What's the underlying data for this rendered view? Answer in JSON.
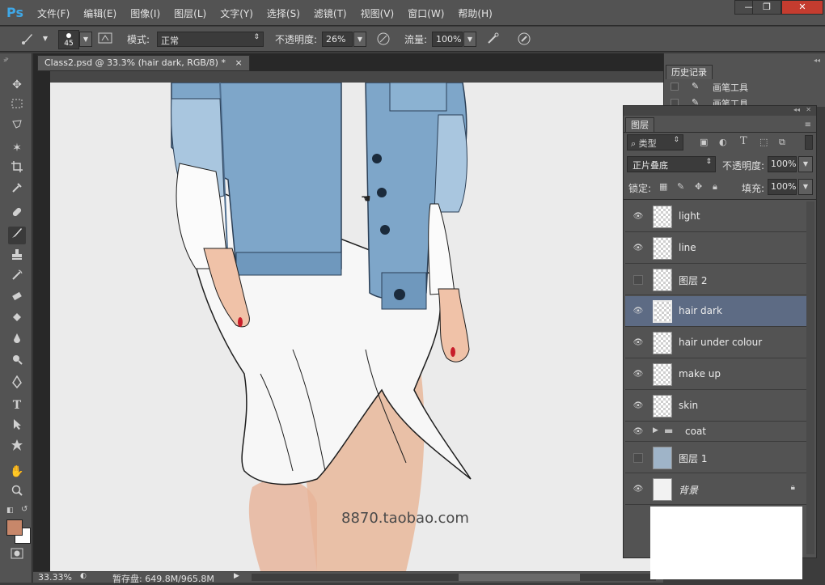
{
  "app": {
    "logo": "Ps"
  },
  "menu": [
    "文件(F)",
    "编辑(E)",
    "图像(I)",
    "图层(L)",
    "文字(Y)",
    "选择(S)",
    "滤镜(T)",
    "视图(V)",
    "窗口(W)",
    "帮助(H)"
  ],
  "window_controls": {
    "minimize": "—",
    "restore": "❐",
    "close": "✕"
  },
  "options": {
    "brush_size": "45",
    "mode_label": "模式:",
    "mode_value": "正常",
    "opacity_label": "不透明度:",
    "opacity_value": "26%",
    "flow_label": "流量:",
    "flow_value": "100%"
  },
  "document": {
    "tab_title": "Class2.psd @ 33.3% (hair dark, RGB/8) *",
    "tab_close": "×"
  },
  "status": {
    "zoom": "33.33%",
    "scratch": "暂存盘: 649.8M/965.8M"
  },
  "watermark": "8870.taobao.com",
  "history": {
    "tab": "历史记录",
    "items": [
      "画笔工具",
      "画笔工具"
    ]
  },
  "layers": {
    "tab": "图层",
    "filter_kind": "类型",
    "blend_mode": "正片叠底",
    "opacity_label": "不透明度:",
    "opacity_value": "100%",
    "lock_label": "锁定:",
    "fill_label": "填充:",
    "fill_value": "100%",
    "items": [
      {
        "name": "light",
        "visible": true
      },
      {
        "name": "line",
        "visible": true
      },
      {
        "name": "图层 2",
        "visible": false
      },
      {
        "name": "hair dark",
        "visible": true,
        "selected": true
      },
      {
        "name": "hair under colour",
        "visible": true
      },
      {
        "name": "make up",
        "visible": true
      },
      {
        "name": "skin",
        "visible": true
      },
      {
        "name": "coat",
        "visible": true,
        "group": true
      },
      {
        "name": "图层 1",
        "visible": false
      },
      {
        "name": "背景",
        "visible": true,
        "locked": true
      }
    ]
  },
  "colors": {
    "foreground": "#c7876a",
    "background": "#ffffff",
    "accent": "#5d6b84"
  }
}
